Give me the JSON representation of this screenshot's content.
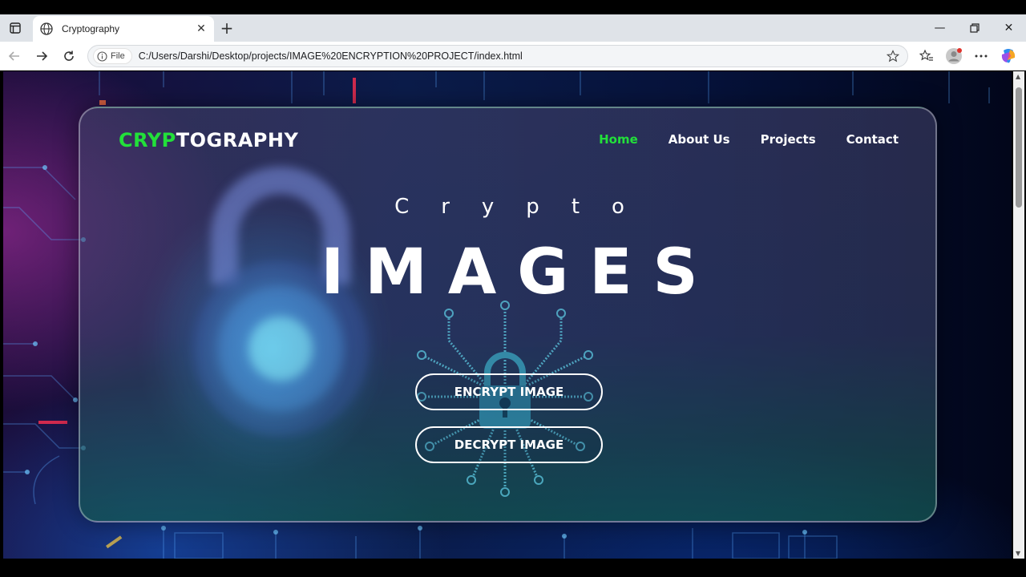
{
  "browser": {
    "tab_title": "Cryptography",
    "file_chip_label": "File",
    "url": "C:/Users/Darshi/Desktop/projects/IMAGE%20ENCRYPTION%20PROJECT/index.html"
  },
  "page": {
    "brand_green": "CRYP",
    "brand_white": "TOGRAPHY",
    "nav": {
      "home": "Home",
      "about": "About Us",
      "projects": "Projects",
      "contact": "Contact"
    },
    "hero_small": "Crypto",
    "hero_big": "IMAGES",
    "encrypt_label": "ENCRYPT IMAGE",
    "decrypt_label": "DECRYPT IMAGE"
  },
  "colors": {
    "accent_green": "#22e03a",
    "text_white": "#ffffff"
  },
  "icons": [
    "sidebar-toggle-icon",
    "globe-icon",
    "close-icon",
    "plus-icon",
    "minimize-icon",
    "restore-icon",
    "window-close-icon",
    "back-icon",
    "forward-icon",
    "reload-icon",
    "info-icon",
    "star-icon",
    "favorites-icon",
    "profile-icon",
    "more-icon",
    "copilot-icon",
    "padlock-icon",
    "circuit-chip-icon"
  ]
}
